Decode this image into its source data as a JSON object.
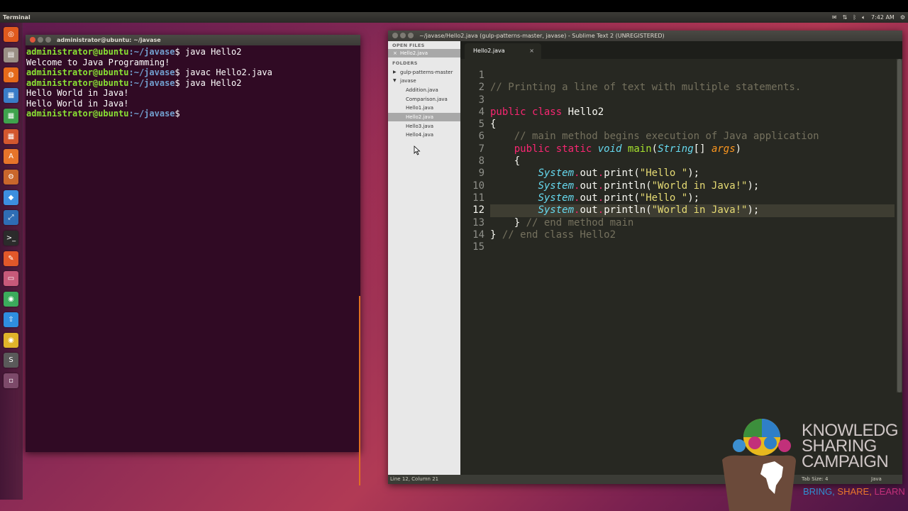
{
  "panel": {
    "app_title": "Terminal",
    "time": "7:42 AM"
  },
  "launcher": {
    "items": [
      {
        "name": "ubuntu-dash-icon",
        "color": "#e05a1e"
      },
      {
        "name": "files-icon",
        "color": "#9a8f85"
      },
      {
        "name": "firefox-icon",
        "color": "#e66a1a"
      },
      {
        "name": "libreoffice-writer-icon",
        "color": "#3a7dc8"
      },
      {
        "name": "libreoffice-calc-icon",
        "color": "#3fa34d"
      },
      {
        "name": "libreoffice-impress-icon",
        "color": "#d3572f"
      },
      {
        "name": "software-center-icon",
        "color": "#e6742a"
      },
      {
        "name": "system-settings-icon",
        "color": "#c9672c"
      },
      {
        "name": "dropbox-icon",
        "color": "#3d8fe0"
      },
      {
        "name": "netbeans-icon",
        "color": "#2f6db5"
      },
      {
        "name": "terminal-icon",
        "color": "#2b2b2b"
      },
      {
        "name": "tool-icon",
        "color": "#e2582a"
      },
      {
        "name": "workspace-icon",
        "color": "#c75a7a"
      },
      {
        "name": "network-icon",
        "color": "#3cab5c"
      },
      {
        "name": "update-manager-icon",
        "color": "#2f8ee0"
      },
      {
        "name": "chrome-icon",
        "color": "#e0b42a"
      },
      {
        "name": "sublime-text-icon",
        "color": "#5a5a5a"
      },
      {
        "name": "trash-icon",
        "color": "#7d4a6a"
      }
    ]
  },
  "terminal": {
    "title": "administrator@ubuntu: ~/javase",
    "lines": [
      {
        "user": "administrator@ubuntu",
        "path": ":~/javase",
        "cmd": "$ java Hello2"
      },
      {
        "out": "Welcome to Java Programming!"
      },
      {
        "user": "administrator@ubuntu",
        "path": ":~/javase",
        "cmd": "$ javac Hello2.java"
      },
      {
        "user": "administrator@ubuntu",
        "path": ":~/javase",
        "cmd": "$ java Hello2"
      },
      {
        "out": "Hello World in Java!"
      },
      {
        "out": "Hello World in Java!"
      },
      {
        "user": "administrator@ubuntu",
        "path": ":~/javase",
        "cmd": "$ "
      }
    ]
  },
  "sublime": {
    "title": "~/javase/Hello2.java (gulp-patterns-master, javase) - Sublime Text 2 (UNREGISTERED)",
    "sidebar": {
      "open_files_header": "OPEN FILES",
      "open_file": "Hello2.java",
      "open_file_close": "×",
      "folders_header": "FOLDERS",
      "folder_1": "gulp-patterns-master",
      "folder_2": "javase",
      "files": [
        "Addition.java",
        "Comparison.java",
        "Hello1.java",
        "Hello2.java",
        "Hello3.java",
        "Hello4.java"
      ],
      "selected_file": "Hello2.java"
    },
    "tab": {
      "label": "Hello2.java",
      "close": "×"
    },
    "status": {
      "position": "Line 12, Column 21",
      "tab_size": "Tab Size: 4",
      "syntax": "Java"
    }
  },
  "watermark": {
    "line1": "KNOWLEDG",
    "line2": "SHARING",
    "line3": "CAMPAIGN",
    "tag_1": "BRING,",
    "tag_2": "SHARE,",
    "tag_3": "LEARN",
    "tag_color_1": "#2f8fd0",
    "tag_color_2": "#e8772a",
    "tag_color_3": "#c2307a"
  }
}
